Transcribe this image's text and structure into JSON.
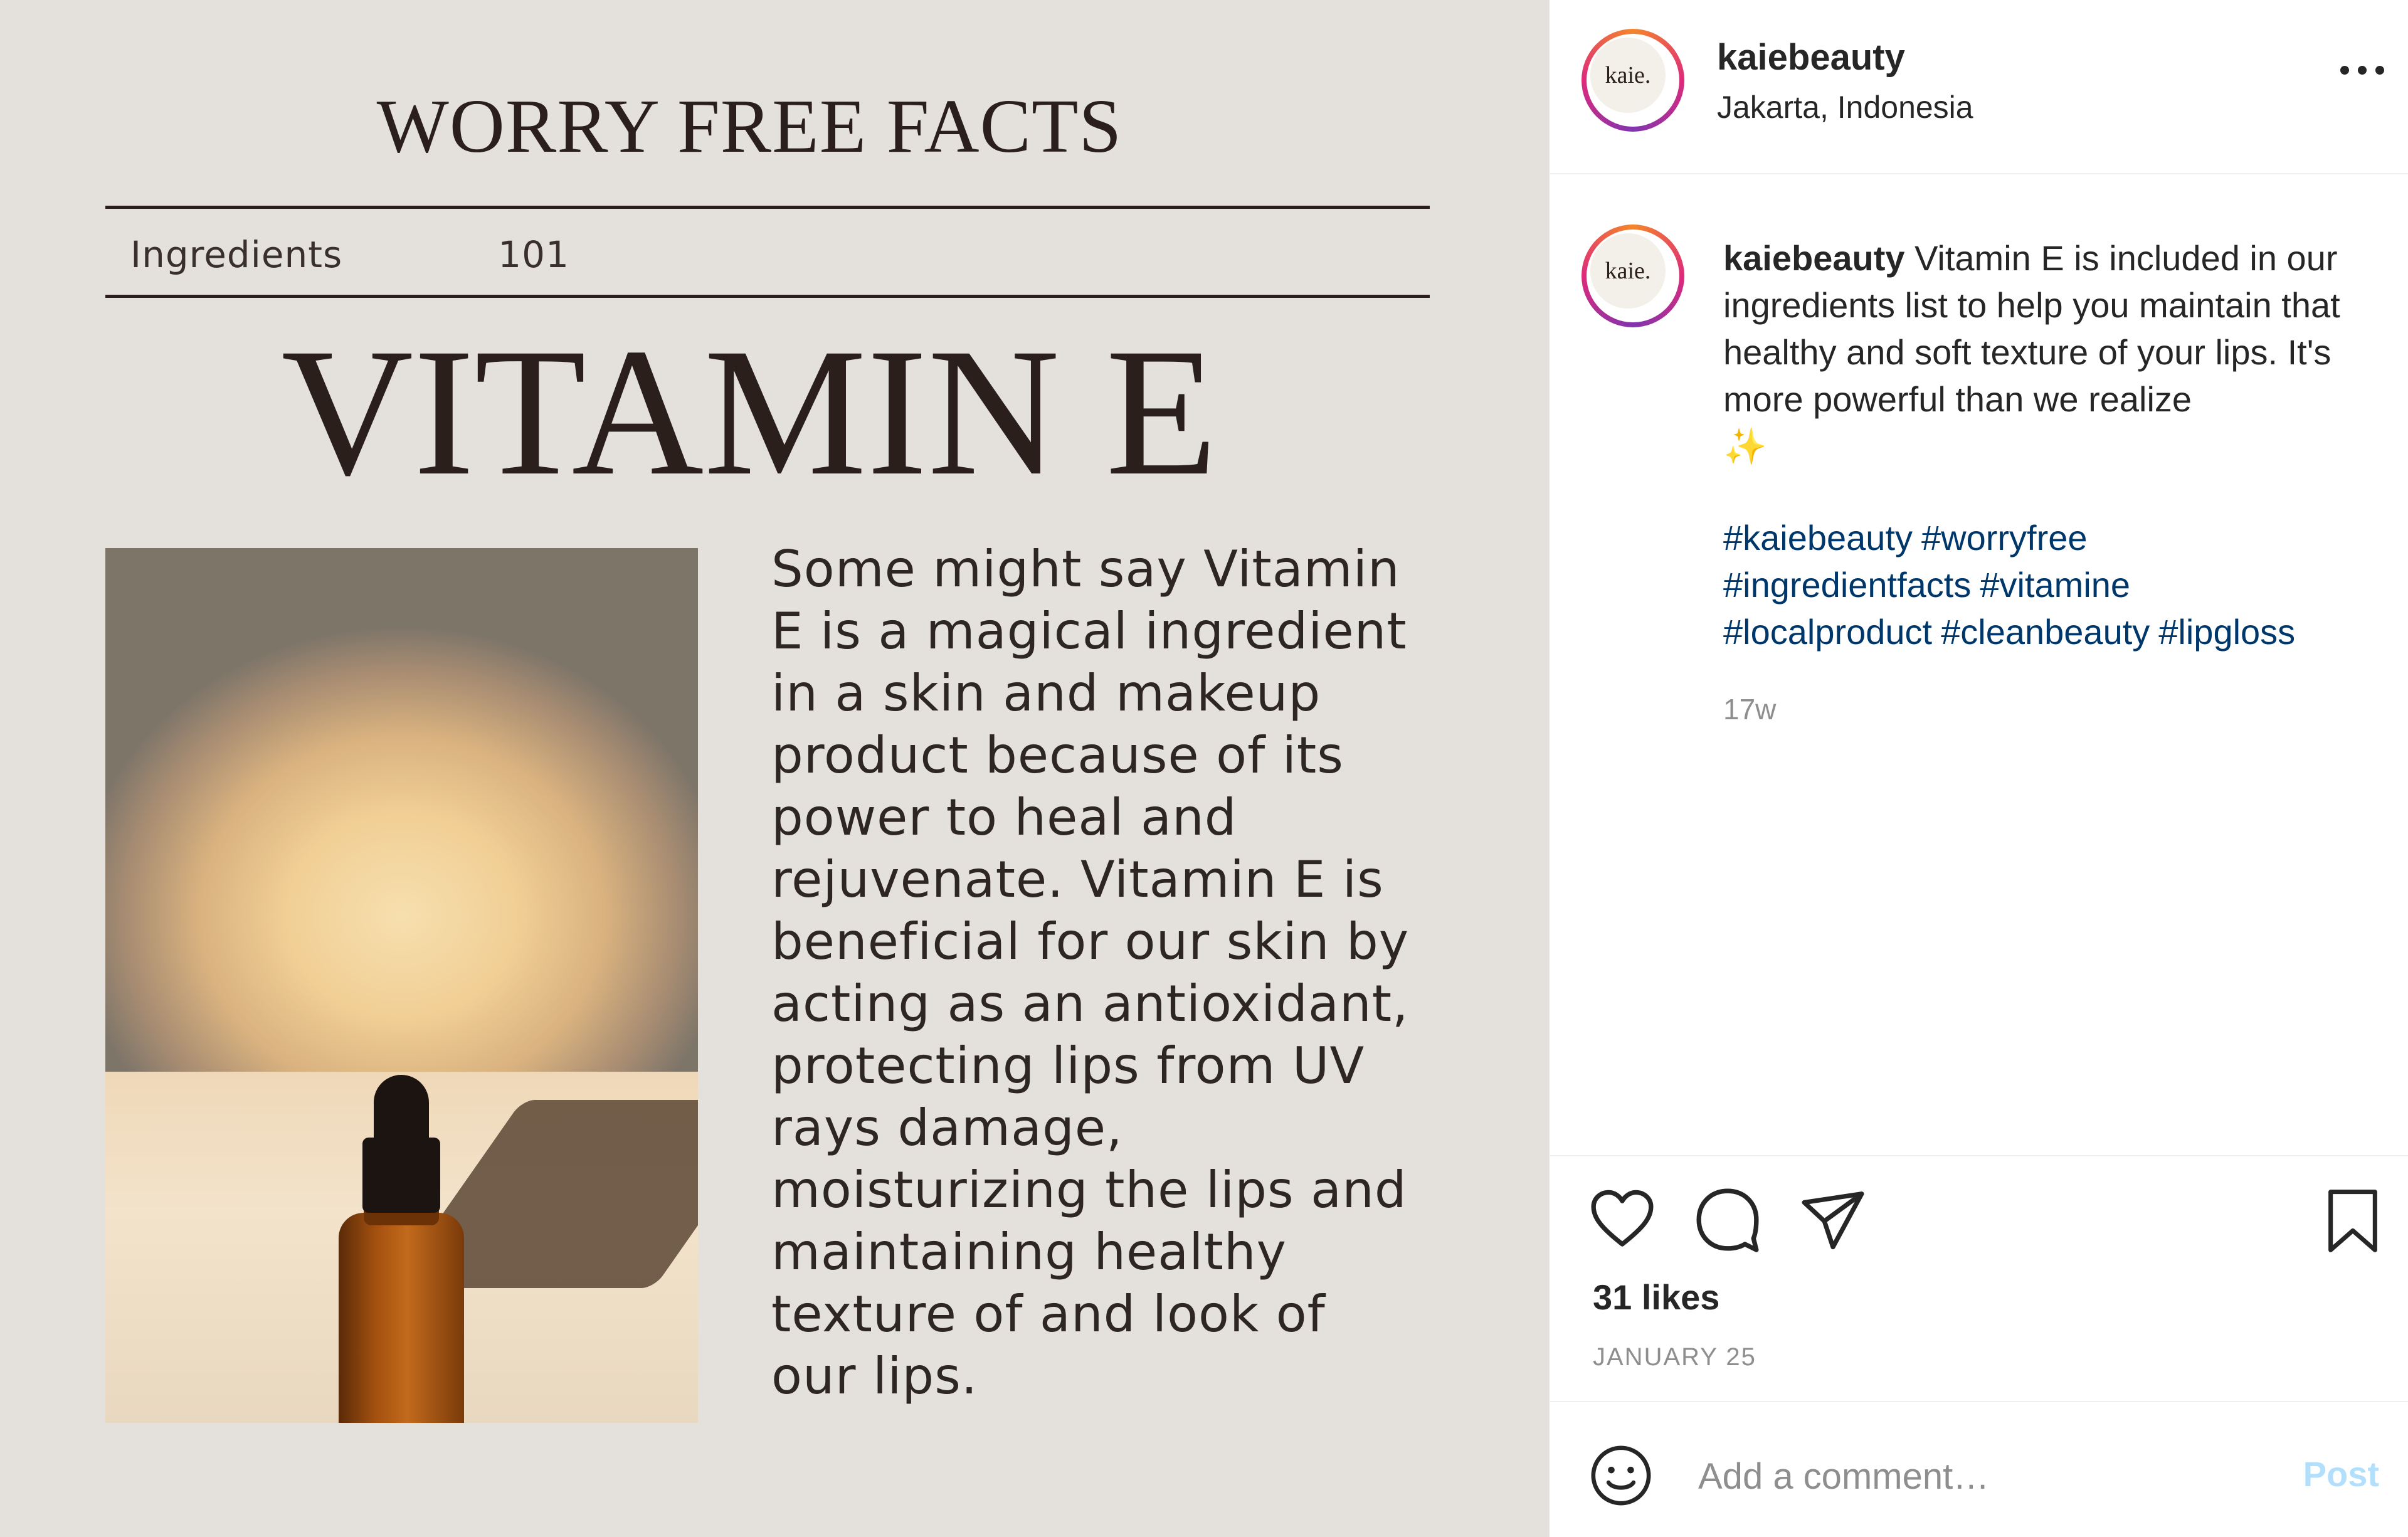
{
  "post_image": {
    "headline": "WORRY FREE FACTS",
    "subheader_left": "Ingredients",
    "subheader_right": "101",
    "title": "VITAMIN E",
    "body": "Some might say Vitamin\nE is a magical ingredient\nin a skin and makeup\nproduct because of its\npower to heal and\nrejuvenate. Vitamin E is\nbeneficial for our skin by\nacting as an antioxidant,\nprotecting lips from UV\nrays damage,\nmoisturizing the lips and\nmaintaining healthy\ntexture of and look of\nour lips."
  },
  "header": {
    "avatar_logo": "kaie.",
    "username": "kaiebeauty",
    "location": "Jakarta, Indonesia",
    "more_icon": "more-horizontal-icon"
  },
  "caption": {
    "avatar_logo": "kaie.",
    "username": "kaiebeauty",
    "text": "Vitamin E is included in our ingredients list to help you maintain that healthy and soft texture of your lips. It's more powerful than we realize",
    "emoji": "✨",
    "hashtags": [
      "#kaiebeauty",
      "#worryfree",
      "#ingredientfacts",
      "#vitamine",
      "#localproduct",
      "#cleanbeauty",
      "#lipgloss"
    ],
    "time_ago": "17w"
  },
  "actions": {
    "icons": [
      "heart-icon",
      "comment-icon",
      "share-icon",
      "bookmark-icon"
    ],
    "likes": "31 likes",
    "date": "JANUARY 25"
  },
  "comment_box": {
    "placeholder": "Add a comment…",
    "post_label": "Post",
    "emoji_icon": "smiley-icon"
  },
  "colors": {
    "image_bg": "#e4e1dc",
    "hashtag": "#00376b",
    "post_button_disabled": "#b2dffc",
    "muted_text": "#8e8e8e"
  }
}
